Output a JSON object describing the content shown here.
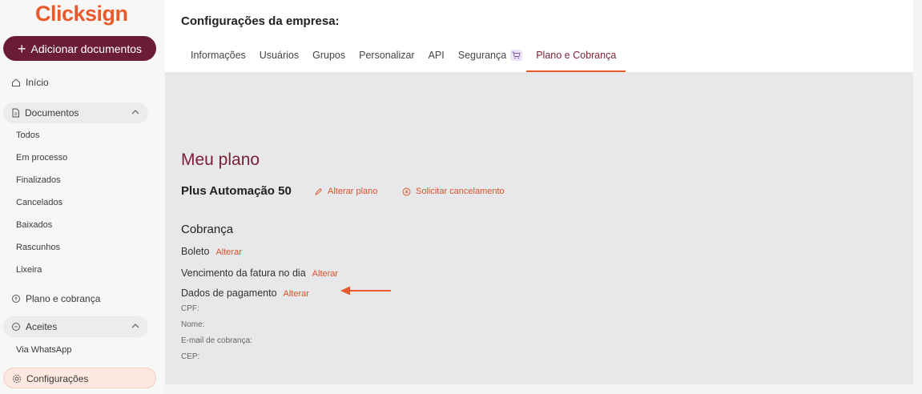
{
  "sidebar": {
    "logo": "Clicksign",
    "add_button": "Adicionar documentos",
    "home": "Início",
    "documents_group": "Documentos",
    "documents_items": [
      "Todos",
      "Em processo",
      "Finalizados",
      "Cancelados",
      "Baixados",
      "Rascunhos",
      "Lixeira"
    ],
    "plan_item": "Plano e cobrança",
    "accepts_group": "Aceites",
    "accepts_items": [
      "Via WhatsApp"
    ],
    "settings_item": "Configurações"
  },
  "header": {
    "title": "Configurações da empresa:",
    "tabs": [
      "Informações",
      "Usuários",
      "Grupos",
      "Personalizar",
      "API",
      "Segurança",
      "Plano e Cobrança"
    ],
    "active_tab": "Plano e Cobrança"
  },
  "plan": {
    "heading": "Meu plano",
    "name": "Plus Automação 50",
    "change_plan": "Alterar plano",
    "cancel": "Solicitar cancelamento"
  },
  "billing": {
    "heading": "Cobrança",
    "method": "Boleto",
    "method_link": "Alterar",
    "due": "Vencimento da fatura no dia",
    "due_link": "Alterar",
    "payment": "Dados de pagamento",
    "payment_link": "Alterar",
    "fields": [
      "CPF:",
      "Nome:",
      "E-mail de cobrança:",
      "CEP:"
    ]
  },
  "colors": {
    "brand": "#e85a2c",
    "primary_dark": "#6b1d35",
    "link": "#d9532b"
  },
  "icons": [
    "plus-icon",
    "home-icon",
    "document-icon",
    "chevron-up-icon",
    "plan-icon",
    "chat-icon",
    "gear-icon",
    "cart-icon",
    "pencil-icon",
    "cancel-icon",
    "arrow-left-icon"
  ]
}
